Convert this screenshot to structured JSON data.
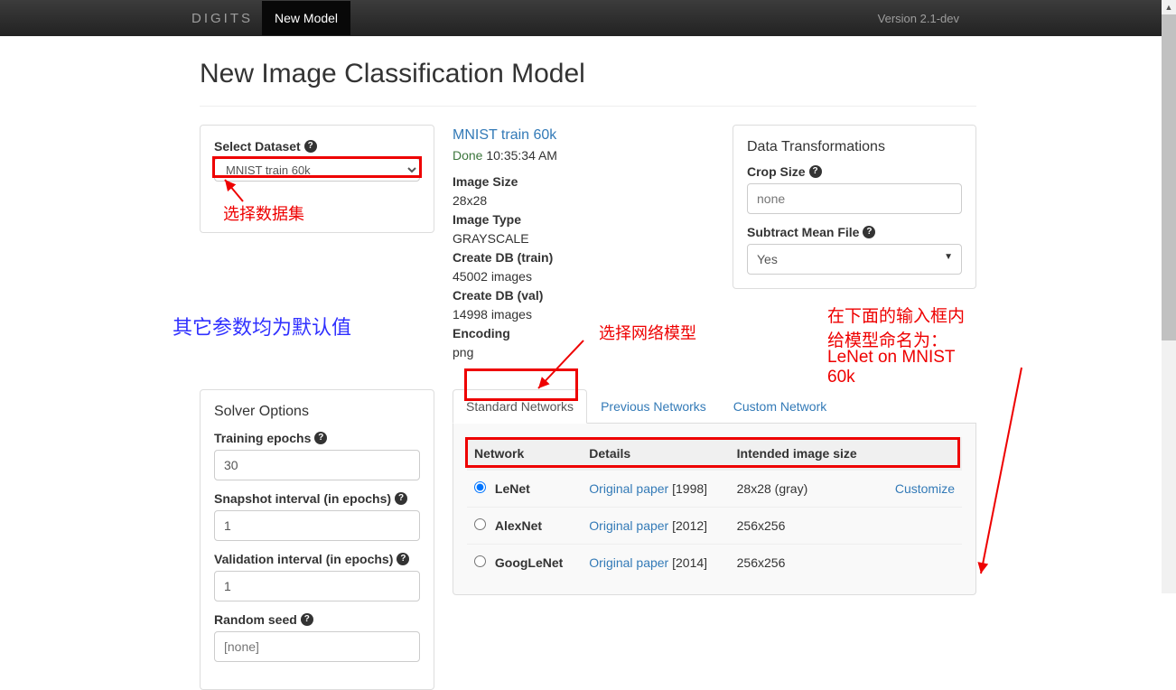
{
  "topbar": {
    "brand": "DIGITS",
    "active": "New Model",
    "version": "Version 2.1-dev"
  },
  "page": {
    "title": "New Image Classification Model"
  },
  "dataset_panel": {
    "title": "Select Dataset",
    "selected": "MNIST train 60k"
  },
  "dataset_info": {
    "link": "MNIST train 60k",
    "status_label": "Done",
    "status_time": "10:35:34 AM",
    "img_size_label": "Image Size",
    "img_size": "28x28",
    "img_type_label": "Image Type",
    "img_type": "GRAYSCALE",
    "db_train_label": "Create DB (train)",
    "db_train": "45002 images",
    "db_val_label": "Create DB (val)",
    "db_val": "14998 images",
    "encoding_label": "Encoding",
    "encoding": "png"
  },
  "transform_panel": {
    "title": "Data Transformations",
    "crop_label": "Crop Size",
    "crop_placeholder": "none",
    "subtract_label": "Subtract Mean File",
    "subtract_value": "Yes"
  },
  "solver_panel": {
    "title": "Solver Options",
    "epochs_label": "Training epochs",
    "epochs_value": "30",
    "snapshot_label": "Snapshot interval (in epochs)",
    "snapshot_value": "1",
    "validation_label": "Validation interval (in epochs)",
    "validation_value": "1",
    "seed_label": "Random seed",
    "seed_placeholder": "[none]"
  },
  "tabs": {
    "standard": "Standard Networks",
    "previous": "Previous Networks",
    "custom": "Custom Network"
  },
  "net_table": {
    "h_network": "Network",
    "h_details": "Details",
    "h_size": "Intended image size",
    "rows": [
      {
        "name": "LeNet",
        "paper": "Original paper",
        "year": "[1998]",
        "size": "28x28 (gray)",
        "action": "Customize"
      },
      {
        "name": "AlexNet",
        "paper": "Original paper",
        "year": "[2012]",
        "size": "256x256",
        "action": ""
      },
      {
        "name": "GoogLeNet",
        "paper": "Original paper",
        "year": "[2014]",
        "size": "256x256",
        "action": ""
      }
    ]
  },
  "annotations": {
    "select_ds": "选择数据集",
    "defaults": "其它参数均为默认值",
    "select_net": "选择网络模型",
    "name_model_line1": "在下面的输入框内给模型命名为：",
    "name_model_line2": "LeNet on MNIST 60k"
  }
}
